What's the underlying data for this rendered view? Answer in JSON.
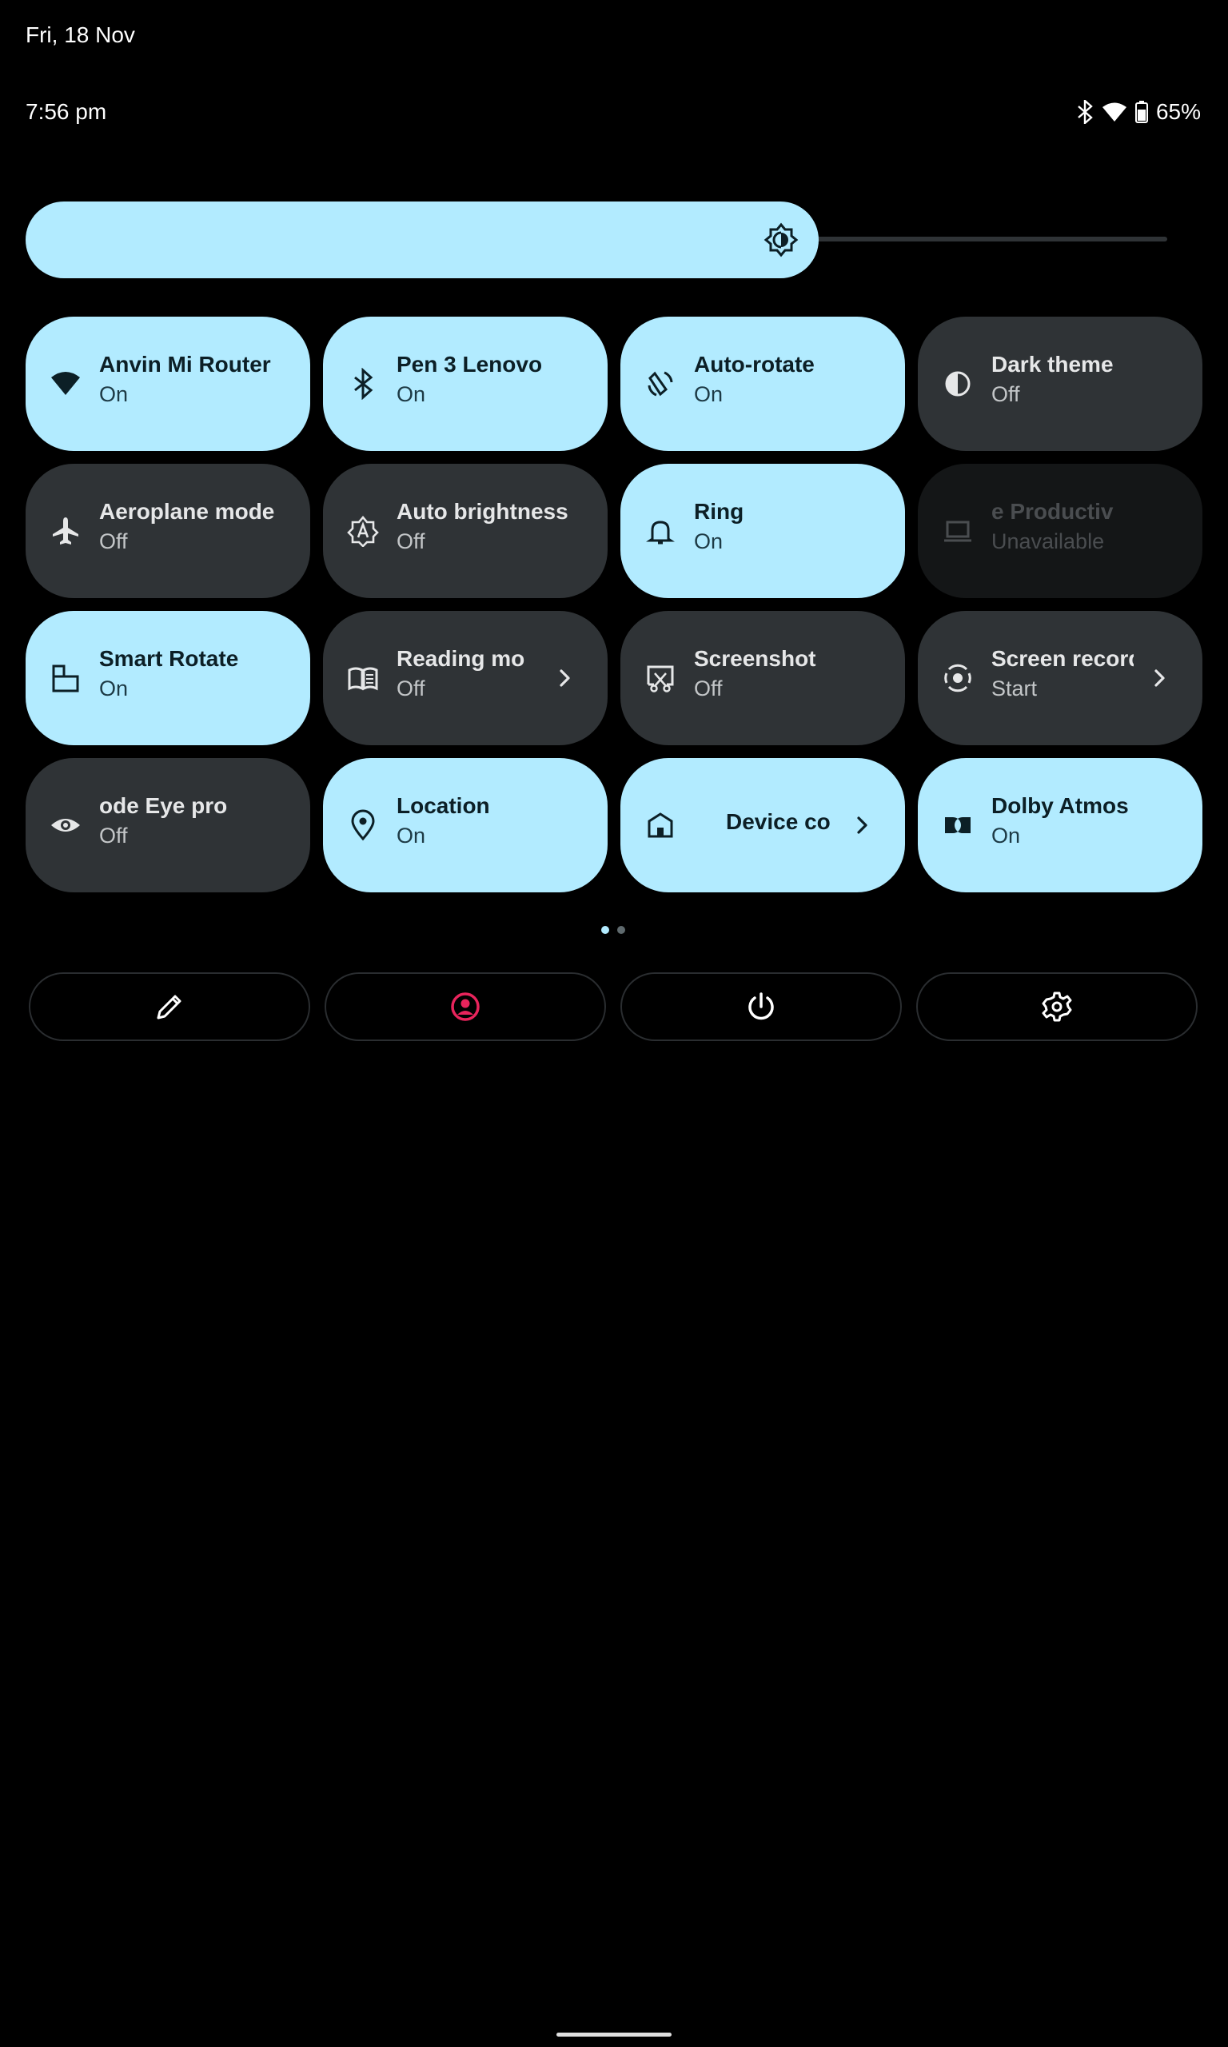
{
  "status_bar": {
    "date": "Fri, 18 Nov",
    "time": "7:56 pm",
    "battery": "65%",
    "icons": [
      "bluetooth-icon",
      "wifi-icon",
      "battery-icon"
    ]
  },
  "brightness": {
    "level": 0.68,
    "icon": "brightness-auto-icon"
  },
  "colors": {
    "tile_on": "#b2ebff",
    "tile_off": "#2f3336",
    "background": "#000000",
    "profile_accent": "#e8245c"
  },
  "tiles": [
    {
      "title": "Anvin Mi Router",
      "subtitle": "On",
      "state": "on",
      "icon": "wifi-icon"
    },
    {
      "title": "Pen 3      Lenovo",
      "subtitle": "On",
      "state": "on",
      "icon": "bluetooth-icon"
    },
    {
      "title": "Auto-rotate",
      "subtitle": "On",
      "state": "on",
      "icon": "auto-rotate-icon"
    },
    {
      "title": "Dark theme",
      "subtitle": "Off",
      "state": "off",
      "icon": "dark-theme-icon"
    },
    {
      "title": "Aeroplane mode",
      "subtitle": "Off",
      "state": "off",
      "icon": "airplane-icon"
    },
    {
      "title": "Auto brightness",
      "subtitle": "Off",
      "state": "off",
      "icon": "auto-brightness-icon"
    },
    {
      "title": "Ring",
      "subtitle": "On",
      "state": "on",
      "icon": "bell-icon"
    },
    {
      "title": "e      Productiv",
      "subtitle": "Unavailable",
      "state": "unavailable",
      "icon": "laptop-icon"
    },
    {
      "title": "Smart Rotate",
      "subtitle": "On",
      "state": "on",
      "icon": "smart-rotate-icon"
    },
    {
      "title": "Reading mo",
      "subtitle": "Off",
      "state": "off",
      "icon": "book-icon",
      "chevron": true
    },
    {
      "title": "Screenshot",
      "subtitle": "Off",
      "state": "off",
      "icon": "screenshot-icon"
    },
    {
      "title": "Screen record",
      "subtitle": "Start",
      "state": "off",
      "icon": "screen-record-icon",
      "chevron": true
    },
    {
      "title": "ode         Eye pro",
      "subtitle": "Off",
      "state": "off",
      "icon": "eye-icon"
    },
    {
      "title": "Location",
      "subtitle": "On",
      "state": "on",
      "icon": "location-icon"
    },
    {
      "title": "Device co",
      "subtitle": "",
      "state": "on",
      "icon": "home-icon",
      "chevron": true
    },
    {
      "title": "Dolby Atmos",
      "subtitle": "On",
      "state": "on",
      "icon": "dolby-icon"
    }
  ],
  "pager": {
    "pages": 2,
    "current": 1
  },
  "footer_buttons": [
    "edit-icon",
    "profile-icon",
    "power-icon",
    "settings-icon"
  ]
}
